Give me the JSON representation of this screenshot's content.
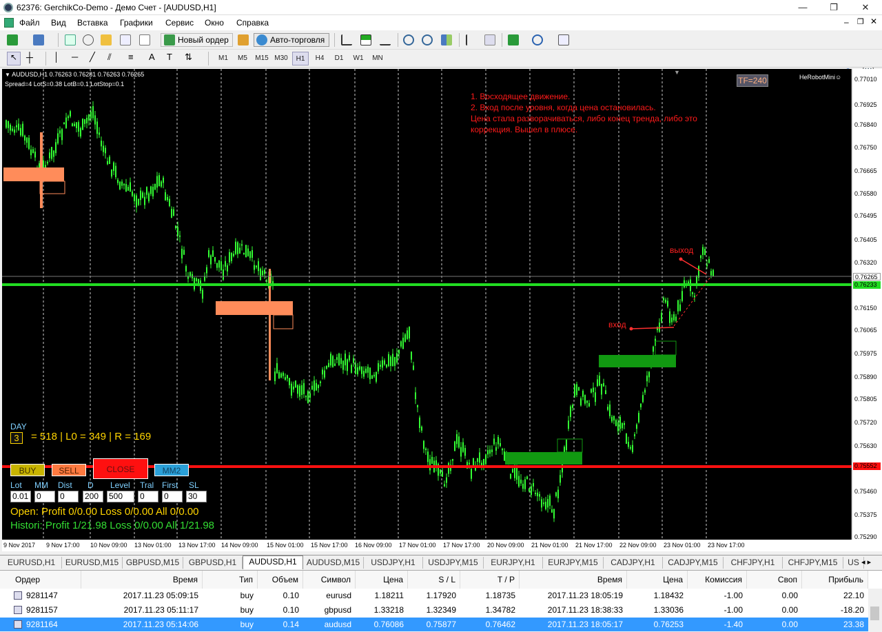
{
  "window": {
    "title": "62376: GerchikCo-Demo - Демо Счет - [AUDUSD,H1]",
    "min": "—",
    "max": "❐",
    "close": "✕"
  },
  "menu": {
    "items": [
      "Файл",
      "Вид",
      "Вставка",
      "Графики",
      "Сервис",
      "Окно",
      "Справка"
    ]
  },
  "toolbar": {
    "new_order": "Новый ордер",
    "autotrade": "Авто-торговля",
    "timeframes": [
      "M1",
      "M5",
      "M15",
      "M30",
      "H1",
      "H4",
      "D1",
      "W1",
      "MN"
    ],
    "active_timeframe": "H1"
  },
  "chart": {
    "symbol_line": "AUDUSD,H1  0.76263 0.76281 0.76263 0.76265",
    "params_line": "Spread=4  LotS=0.38  LotB=0.1  LotStop=0.1",
    "tf_badge": "TF=240",
    "robot": "HeRobotMini☺",
    "note_lines": [
      "1. Восходящее движение.",
      "2. Вход после уровня, когда цена остановилась.",
      "Цена стала разворачиваться, либо конец тренда, либо это",
      "коррекция. Вышел в плюсе."
    ],
    "label_exit": "выход",
    "label_entry": "вход",
    "bull_color": "#33ff33",
    "green_line_color": "#22dd22",
    "red_line_color": "#ff1010",
    "salmon_color": "#ff8c5a",
    "price_axis": [
      "0.77010",
      "0.76925",
      "0.76840",
      "0.76750",
      "0.76665",
      "0.76580",
      "0.76495",
      "0.76405",
      "0.76320",
      "0.76150",
      "0.76065",
      "0.75975",
      "0.75890",
      "0.75805",
      "0.75720",
      "0.75630",
      "0.75460",
      "0.75375",
      "0.75290"
    ],
    "price_tag_current": "0.76265",
    "price_tag_green": "0.76233",
    "price_tag_red": "0.75552",
    "time_axis": [
      "9 Nov 2017",
      "9 Nov 17:00",
      "10 Nov 09:00",
      "13 Nov 01:00",
      "13 Nov 17:00",
      "14 Nov 09:00",
      "15 Nov 01:00",
      "15 Nov 17:00",
      "16 Nov 09:00",
      "17 Nov 01:00",
      "17 Nov 17:00",
      "20 Nov 09:00",
      "21 Nov 01:00",
      "21 Nov 17:00",
      "22 Nov 09:00",
      "23 Nov 01:00",
      "23 Nov 17:00"
    ]
  },
  "panel": {
    "day_label": "DAY",
    "day_value": "3",
    "stats": "= 518  |  L0 = 349  |  R = 169",
    "buy": "BUY",
    "sell": "SELL",
    "close": "CLOSE",
    "mm": "MM2",
    "field_labels": [
      "Lot",
      "MM",
      "Dist",
      "D",
      "Level",
      "Tral",
      "First",
      "SL"
    ],
    "field_values": [
      "0.01",
      "0",
      "0",
      "200",
      "500",
      "0",
      "0",
      "30"
    ],
    "open_line": "Open:  Profit 0/0.00   Loss 0/0.00   All 0/0.00",
    "history_line": "Histori: Profit 1/21.98   Loss 0/0.00   All 1/21.98"
  },
  "tabs": [
    "EURUSD,H1",
    "EURUSD,M15",
    "GBPUSD,M15",
    "GBPUSD,H1",
    "AUDUSD,H1",
    "AUDUSD,M15",
    "USDJPY,H1",
    "USDJPY,M15",
    "EURJPY,H1",
    "EURJPY,M15",
    "CADJPY,H1",
    "CADJPY,M15",
    "CHFJPY,H1",
    "CHFJPY,M15",
    "US"
  ],
  "active_tab": "AUDUSD,H1",
  "terminal": {
    "headers": [
      "Ордер",
      "Время",
      "Тип",
      "Объем",
      "Символ",
      "Цена",
      "S / L",
      "T / P",
      "Время",
      "Цена",
      "Комиссия",
      "Своп",
      "Прибыль"
    ],
    "rows": [
      [
        "9281147",
        "2017.11.23 05:09:15",
        "buy",
        "0.10",
        "eurusd",
        "1.18211",
        "1.17920",
        "1.18735",
        "2017.11.23 18:05:19",
        "1.18432",
        "-1.00",
        "0.00",
        "22.10"
      ],
      [
        "9281157",
        "2017.11.23 05:11:17",
        "buy",
        "0.10",
        "gbpusd",
        "1.33218",
        "1.32349",
        "1.34782",
        "2017.11.23 18:38:33",
        "1.33036",
        "-1.00",
        "0.00",
        "-18.20"
      ],
      [
        "9281164",
        "2017.11.23 05:14:06",
        "buy",
        "0.14",
        "audusd",
        "0.76086",
        "0.75877",
        "0.76462",
        "2017.11.23 18:05:17",
        "0.76253",
        "-1.40",
        "0.00",
        "23.38"
      ]
    ]
  }
}
